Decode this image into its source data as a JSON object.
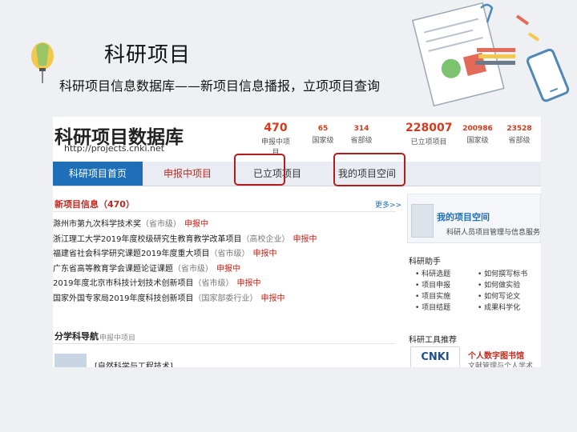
{
  "slide": {
    "title": "科研项目",
    "subtitle": "科研项目信息数据库——新项目信息播报，立项项目查询"
  },
  "colors": {
    "accent_blue": "#1f6fb8",
    "accent_red": "#c0281e",
    "highlight_box": "#b71c1c"
  },
  "site": {
    "name": "科研项目数据库",
    "url": "http://projects.cnki.net",
    "stats": [
      {
        "value": "470",
        "label": "申报中项目"
      },
      {
        "value": "65",
        "label": "国家级"
      },
      {
        "value": "314",
        "label": "省部级"
      },
      {
        "value": "228007",
        "label": "已立项项目"
      },
      {
        "value": "200986",
        "label": "国家级"
      },
      {
        "value": "23528",
        "label": "省部级"
      }
    ],
    "nav": [
      {
        "label": "科研项目首页"
      },
      {
        "label": "申报中项目"
      },
      {
        "label": "已立项项目"
      },
      {
        "label": "我的项目空间"
      }
    ],
    "new_info": {
      "heading": "新项目信息（470）",
      "more": "更多>>",
      "items": [
        {
          "title": "滁州市第九次科学技术奖",
          "tag": "（省市级）",
          "status": "申报中"
        },
        {
          "title": "浙江理工大学2019年度校级研究生教育教学改革项目",
          "tag": "（高校企业）",
          "status": "申报中"
        },
        {
          "title": "福建省社会科学研究课题2019年度重大项目",
          "tag": "（省市级）",
          "status": "申报中"
        },
        {
          "title": "广东省高等教育学会课题论证课题",
          "tag": "（省市级）",
          "status": "申报中"
        },
        {
          "title": "2019年度北京市科技计划技术创新项目",
          "tag": "（省市级）",
          "status": "申报中"
        },
        {
          "title": "国家外国专家局2019年度科技创新项目",
          "tag": "（国家部委行业）",
          "status": "申报中"
        }
      ]
    },
    "category": {
      "heading": "分学科导航",
      "sub": "申报中项目",
      "first_item": "[自然科学与工程技术]"
    },
    "sidebar": {
      "title": "我的项目空间",
      "desc": "科研人员项目管理与信息服务",
      "helper_heading": "科研助手",
      "helpers": [
        "科研选题",
        "项目申报",
        "项目实施",
        "项目结题",
        "如何撰写标书",
        "如何做实验",
        "如何写论文",
        "成果科学化"
      ],
      "tools_heading": "科研工具推荐",
      "tool_logo": "CNKI",
      "tool_title": "个人数字图书馆",
      "tool_desc": "文献管理与个人学术空间"
    }
  }
}
